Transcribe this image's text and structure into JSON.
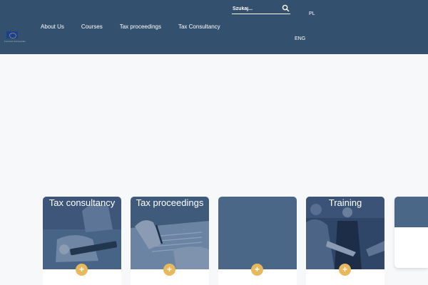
{
  "header": {
    "logo_caption": "Fundusze Europejskie",
    "nav": [
      "About Us",
      "Courses",
      "Tax proceedings",
      "Tax Consultancy"
    ],
    "search": {
      "placeholder": "Szukaj..."
    },
    "languages": [
      "PL",
      "ENG"
    ]
  },
  "cards": [
    {
      "title": "Tax consultancy",
      "plus": "+"
    },
    {
      "title": "Tax proceedings",
      "plus": "+"
    },
    {
      "title": "",
      "plus": "+"
    },
    {
      "title": "Training",
      "plus": "+"
    }
  ],
  "colors": {
    "header_bg": "#34506f",
    "accent": "#e8b95c",
    "card_overlay": "#34506f",
    "page_bg": "#f7f8fa"
  },
  "icons": [
    "search-icon",
    "plus-icon",
    "eu-flag-logo"
  ]
}
